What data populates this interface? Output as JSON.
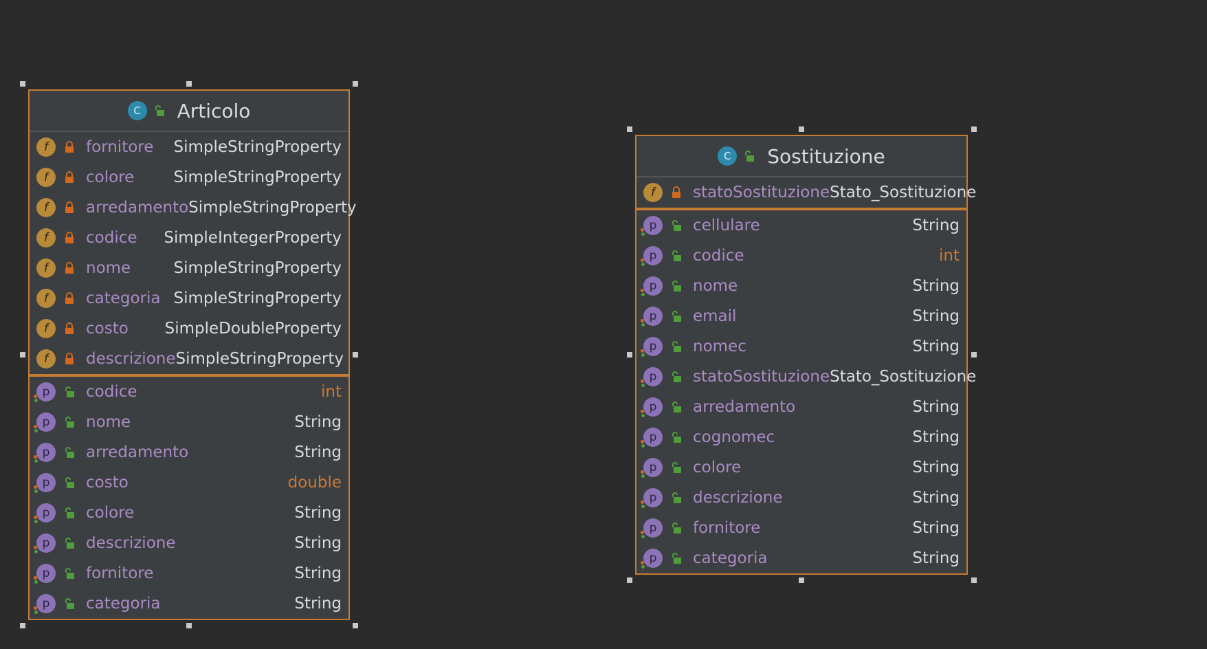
{
  "diagram": {
    "classes": [
      {
        "name": "Articolo",
        "kind_badge": "C",
        "fields": [
          {
            "name": "fornitore",
            "type": "SimpleStringProperty"
          },
          {
            "name": "colore",
            "type": "SimpleStringProperty"
          },
          {
            "name": "arredamento",
            "type": "SimpleStringProperty"
          },
          {
            "name": "codice",
            "type": "SimpleIntegerProperty"
          },
          {
            "name": "nome",
            "type": "SimpleStringProperty"
          },
          {
            "name": "categoria",
            "type": "SimpleStringProperty"
          },
          {
            "name": "costo",
            "type": "SimpleDoubleProperty"
          },
          {
            "name": "descrizione",
            "type": "SimpleStringProperty"
          }
        ],
        "properties": [
          {
            "name": "codice",
            "type": "int"
          },
          {
            "name": "nome",
            "type": "String"
          },
          {
            "name": "arredamento",
            "type": "String"
          },
          {
            "name": "costo",
            "type": "double"
          },
          {
            "name": "colore",
            "type": "String"
          },
          {
            "name": "descrizione",
            "type": "String"
          },
          {
            "name": "fornitore",
            "type": "String"
          },
          {
            "name": "categoria",
            "type": "String"
          }
        ]
      },
      {
        "name": "Sostituzione",
        "kind_badge": "C",
        "fields": [
          {
            "name": "statoSostituzione",
            "type": "Stato_Sostituzione"
          }
        ],
        "properties": [
          {
            "name": "cellulare",
            "type": "String"
          },
          {
            "name": "codice",
            "type": "int"
          },
          {
            "name": "nome",
            "type": "String"
          },
          {
            "name": "email",
            "type": "String"
          },
          {
            "name": "nomec",
            "type": "String"
          },
          {
            "name": "statoSostituzione",
            "type": "Stato_Sostituzione"
          },
          {
            "name": "arredamento",
            "type": "String"
          },
          {
            "name": "cognomec",
            "type": "String"
          },
          {
            "name": "colore",
            "type": "String"
          },
          {
            "name": "descrizione",
            "type": "String"
          },
          {
            "name": "fornitore",
            "type": "String"
          },
          {
            "name": "categoria",
            "type": "String"
          }
        ]
      }
    ],
    "badges": {
      "field": "f",
      "property": "p"
    },
    "colors": {
      "background": "#2b2b2b",
      "box": "#3c3f41",
      "border": "#c57b31",
      "member_name": "#a98bc4",
      "type_text": "#d7dbde",
      "primitive_type": "#cc7832",
      "private_lock": "#d2691e",
      "public_lock": "#4f9e3b"
    }
  }
}
